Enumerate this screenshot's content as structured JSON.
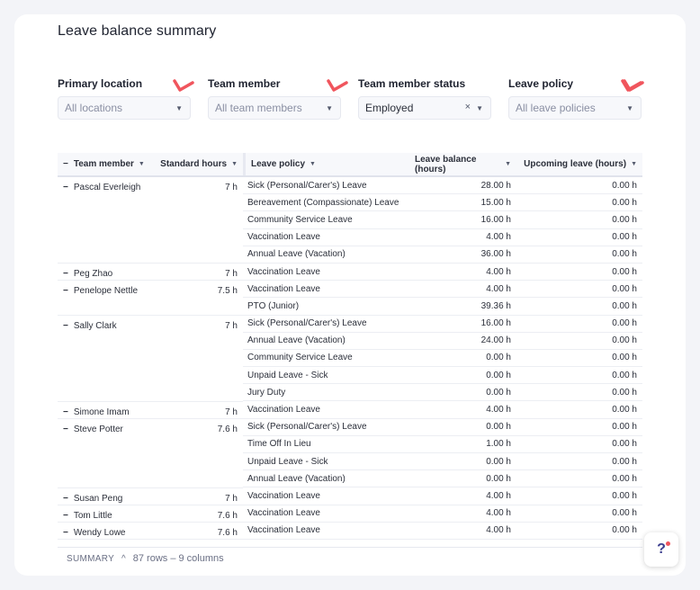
{
  "page": {
    "title": "Leave balance summary"
  },
  "filters": [
    {
      "label": "Primary location",
      "value": "All locations",
      "filled": false
    },
    {
      "label": "Team member",
      "value": "All team members",
      "filled": false
    },
    {
      "label": "Team member status",
      "value": "Employed",
      "filled": true,
      "clearable": true
    },
    {
      "label": "Leave policy",
      "value": "All leave policies",
      "filled": false
    }
  ],
  "columns": {
    "member": "Team member",
    "hours": "Standard hours",
    "policy": "Leave policy",
    "balance": "Leave balance (hours)",
    "upcoming": "Upcoming leave (hours)"
  },
  "members": [
    {
      "name": "Pascal Everleigh",
      "hours": "7 h",
      "policies": [
        {
          "policy": "Sick (Personal/Carer's) Leave",
          "balance": "28.00 h",
          "upcoming": "0.00 h"
        },
        {
          "policy": "Bereavement (Compassionate) Leave",
          "balance": "15.00 h",
          "upcoming": "0.00 h"
        },
        {
          "policy": "Community Service Leave",
          "balance": "16.00 h",
          "upcoming": "0.00 h"
        },
        {
          "policy": "Vaccination Leave",
          "balance": "4.00 h",
          "upcoming": "0.00 h"
        },
        {
          "policy": "Annual Leave (Vacation)",
          "balance": "36.00 h",
          "upcoming": "0.00 h"
        }
      ]
    },
    {
      "name": "Peg Zhao",
      "hours": "7 h",
      "policies": [
        {
          "policy": "Vaccination Leave",
          "balance": "4.00 h",
          "upcoming": "0.00 h"
        }
      ]
    },
    {
      "name": "Penelope Nettle",
      "hours": "7.5 h",
      "policies": [
        {
          "policy": "Vaccination Leave",
          "balance": "4.00 h",
          "upcoming": "0.00 h"
        },
        {
          "policy": "PTO (Junior)",
          "balance": "39.36 h",
          "upcoming": "0.00 h"
        }
      ]
    },
    {
      "name": "Sally Clark",
      "hours": "7 h",
      "policies": [
        {
          "policy": "Sick (Personal/Carer's) Leave",
          "balance": "16.00 h",
          "upcoming": "0.00 h"
        },
        {
          "policy": "Annual Leave (Vacation)",
          "balance": "24.00 h",
          "upcoming": "0.00 h"
        },
        {
          "policy": "Community Service Leave",
          "balance": "0.00 h",
          "upcoming": "0.00 h"
        },
        {
          "policy": "Unpaid Leave - Sick",
          "balance": "0.00 h",
          "upcoming": "0.00 h"
        },
        {
          "policy": "Jury Duty",
          "balance": "0.00 h",
          "upcoming": "0.00 h"
        }
      ]
    },
    {
      "name": "Simone Imam",
      "hours": "7 h",
      "policies": [
        {
          "policy": "Vaccination Leave",
          "balance": "4.00 h",
          "upcoming": "0.00 h"
        }
      ]
    },
    {
      "name": "Steve Potter",
      "hours": "7.6 h",
      "policies": [
        {
          "policy": "Sick (Personal/Carer's) Leave",
          "balance": "0.00 h",
          "upcoming": "0.00 h"
        },
        {
          "policy": "Time Off In Lieu",
          "balance": "1.00 h",
          "upcoming": "0.00 h"
        },
        {
          "policy": "Unpaid Leave - Sick",
          "balance": "0.00 h",
          "upcoming": "0.00 h"
        },
        {
          "policy": "Annual Leave (Vacation)",
          "balance": "0.00 h",
          "upcoming": "0.00 h"
        }
      ]
    },
    {
      "name": "Susan Peng",
      "hours": "7 h",
      "policies": [
        {
          "policy": "Vaccination Leave",
          "balance": "4.00 h",
          "upcoming": "0.00 h"
        }
      ]
    },
    {
      "name": "Tom Little",
      "hours": "7.6 h",
      "policies": [
        {
          "policy": "Vaccination Leave",
          "balance": "4.00 h",
          "upcoming": "0.00 h"
        }
      ]
    },
    {
      "name": "Wendy Lowe",
      "hours": "7.6 h",
      "policies": [
        {
          "policy": "Vaccination Leave",
          "balance": "4.00 h",
          "upcoming": "0.00 h"
        }
      ]
    }
  ],
  "summary": {
    "label": "SUMMARY",
    "text": "87 rows – 9 columns"
  },
  "help": {
    "label": "?"
  },
  "colors": {
    "annotation_check": "#f0555d",
    "accent": "#3c3f8f"
  }
}
